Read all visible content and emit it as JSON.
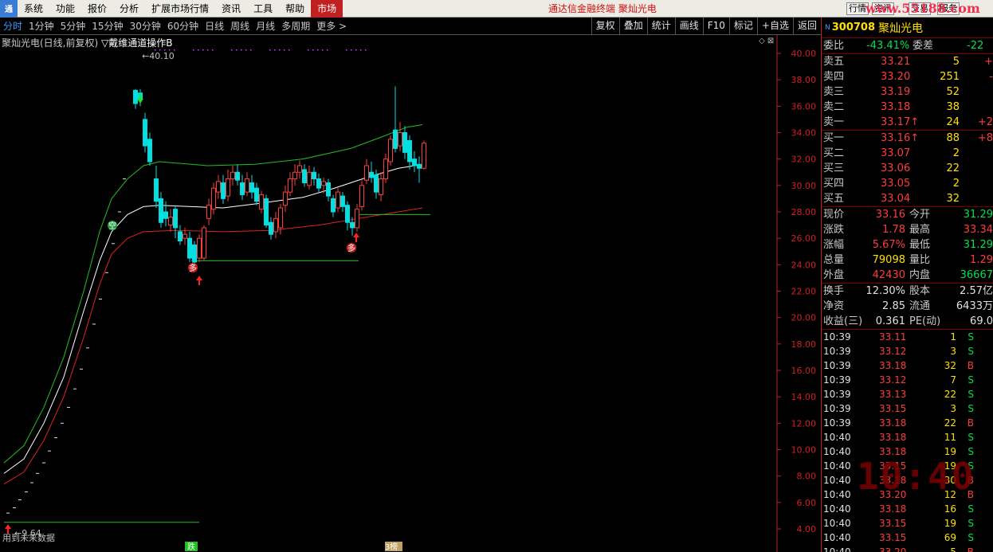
{
  "menubar": {
    "logo": "通",
    "items": [
      "系统",
      "功能",
      "报价",
      "分析",
      "扩展市场行情",
      "资讯",
      "工具",
      "帮助"
    ],
    "market": "市场",
    "title": "通达信金融终端  聚灿光电",
    "right_buttons": [
      "行情",
      "资讯",
      "交易",
      "服务"
    ],
    "watermark": "www.55188.com"
  },
  "periodbar": {
    "items": [
      "分时",
      "1分钟",
      "5分钟",
      "15分钟",
      "30分钟",
      "60分钟",
      "日线",
      "周线",
      "月线",
      "多周期",
      "更多 >"
    ],
    "active_index": 0,
    "tools": [
      "复权",
      "叠加",
      "统计",
      "画线",
      "F10",
      "标记",
      "+自选",
      "返回"
    ]
  },
  "chart": {
    "title": "聚灿光电(日线,前复权)",
    "indicator": "▽戴维通道操作B",
    "high_label": "←40.10",
    "low_label": "←9.64",
    "note": "用到未来数据",
    "ctrl_icons": "◇ ⊠",
    "signal_up": "多",
    "signal_down": "空",
    "bottom_tags": [
      "跌",
      "3榜"
    ],
    "y_ticks": [
      "40.00",
      "38.00",
      "36.00",
      "34.00",
      "32.00",
      "30.00",
      "28.00",
      "26.00",
      "24.00",
      "22.00",
      "20.00",
      "18.00",
      "16.00",
      "14.00",
      "12.00",
      "10.00",
      "8.00",
      "6.00",
      "4.00"
    ],
    "colors": {
      "up": "#ff3c3c",
      "down": "#00e0e0",
      "upper": "#20c020",
      "mid": "#ffffff",
      "lower": "#e02020",
      "support": "#20c020"
    }
  },
  "panel": {
    "header": {
      "n": "N",
      "code": "300708",
      "name": "聚灿光电"
    },
    "ratio": {
      "label": "委比",
      "value": "-43.41%",
      "label2": "委差",
      "value2": "-22"
    },
    "asks": [
      {
        "label": "卖五",
        "price": "33.21",
        "vol": "5",
        "chg": "+"
      },
      {
        "label": "卖四",
        "price": "33.20",
        "vol": "251",
        "chg": "-"
      },
      {
        "label": "卖三",
        "price": "33.19",
        "vol": "52",
        "chg": ""
      },
      {
        "label": "卖二",
        "price": "33.18",
        "vol": "38",
        "chg": ""
      },
      {
        "label": "卖一",
        "price": "33.17↑",
        "vol": "24",
        "chg": "+2"
      }
    ],
    "bids": [
      {
        "label": "买一",
        "price": "33.16↑",
        "vol": "88",
        "chg": "+8"
      },
      {
        "label": "买二",
        "price": "33.07",
        "vol": "2",
        "chg": ""
      },
      {
        "label": "买三",
        "price": "33.06",
        "vol": "22",
        "chg": ""
      },
      {
        "label": "买四",
        "price": "33.05",
        "vol": "2",
        "chg": ""
      },
      {
        "label": "买五",
        "price": "33.04",
        "vol": "32",
        "chg": ""
      }
    ],
    "quote": [
      {
        "l1": "现价",
        "v1": "33.16",
        "c1": "red",
        "l2": "今开",
        "v2": "31.29",
        "c2": "green"
      },
      {
        "l1": "涨跌",
        "v1": "1.78",
        "c1": "red",
        "l2": "最高",
        "v2": "33.34",
        "c2": "red"
      },
      {
        "l1": "涨幅",
        "v1": "5.67%",
        "c1": "red",
        "l2": "最低",
        "v2": "31.29",
        "c2": "green"
      },
      {
        "l1": "总量",
        "v1": "79098",
        "c1": "yellow",
        "l2": "量比",
        "v2": "1.29",
        "c2": "red"
      },
      {
        "l1": "外盘",
        "v1": "42430",
        "c1": "red",
        "l2": "内盘",
        "v2": "36667",
        "c2": "green"
      }
    ],
    "stats": [
      {
        "l1": "换手",
        "v1": "12.30%",
        "l2": "股本",
        "v2": "2.57亿"
      },
      {
        "l1": "净资",
        "v1": "2.85",
        "l2": "流通",
        "v2": "6433万"
      },
      {
        "l1": "收益(三)",
        "v1": "0.361",
        "l2": "PE(动)",
        "v2": "69.0"
      }
    ],
    "ticks": [
      {
        "t": "10:39",
        "p": "33.11",
        "v": "1",
        "s": "S"
      },
      {
        "t": "10:39",
        "p": "33.12",
        "v": "3",
        "s": "S"
      },
      {
        "t": "10:39",
        "p": "33.18",
        "v": "32",
        "s": "B"
      },
      {
        "t": "10:39",
        "p": "33.12",
        "v": "7",
        "s": "S"
      },
      {
        "t": "10:39",
        "p": "33.13",
        "v": "22",
        "s": "S"
      },
      {
        "t": "10:39",
        "p": "33.15",
        "v": "3",
        "s": "S"
      },
      {
        "t": "10:39",
        "p": "33.18",
        "v": "22",
        "s": "B"
      },
      {
        "t": "10:40",
        "p": "33.18",
        "v": "11",
        "s": "S"
      },
      {
        "t": "10:40",
        "p": "33.18",
        "v": "19",
        "s": "S"
      },
      {
        "t": "10:40",
        "p": "33.15",
        "v": "19",
        "s": "S"
      },
      {
        "t": "10:40",
        "p": "33.18",
        "v": "30",
        "s": "B"
      },
      {
        "t": "10:40",
        "p": "33.20",
        "v": "12",
        "s": "B"
      },
      {
        "t": "10:40",
        "p": "33.18",
        "v": "16",
        "s": "S"
      },
      {
        "t": "10:40",
        "p": "33.15",
        "v": "19",
        "s": "S"
      },
      {
        "t": "10:40",
        "p": "33.15",
        "v": "69",
        "s": "S"
      },
      {
        "t": "10:40",
        "p": "33.20",
        "v": "5",
        "s": "B"
      }
    ],
    "clock": "10:40"
  }
}
